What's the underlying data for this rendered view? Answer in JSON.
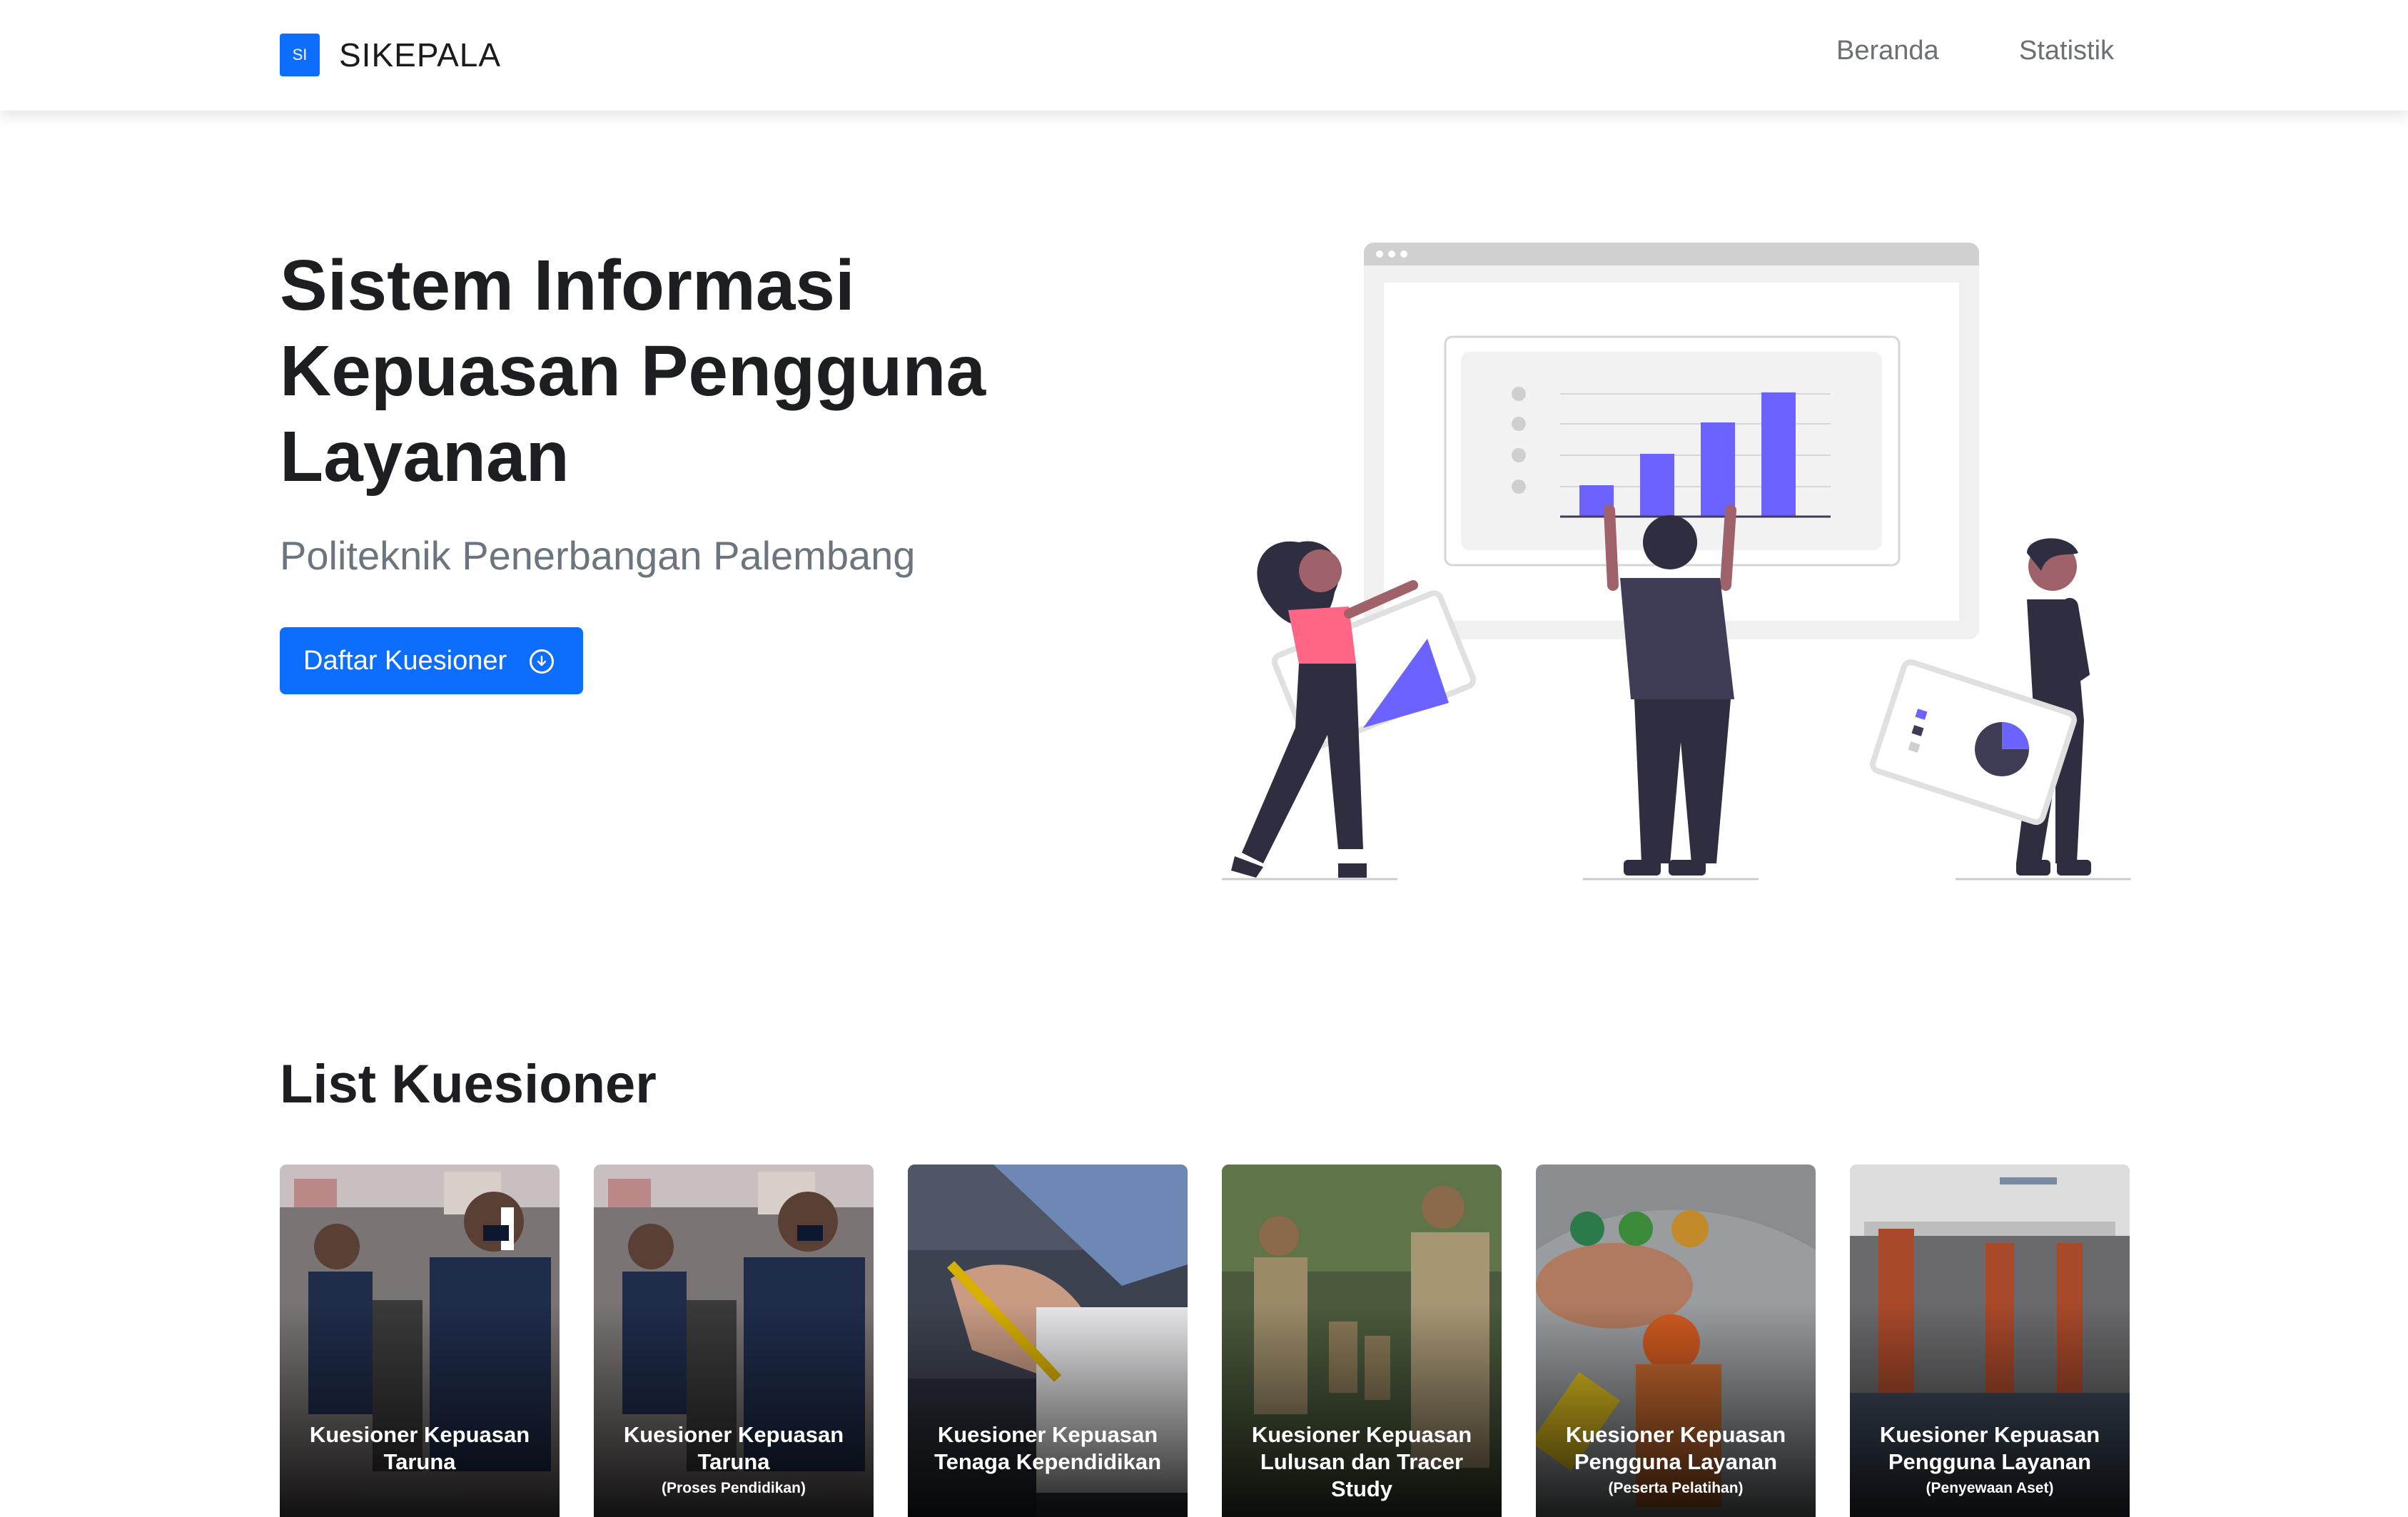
{
  "navbar": {
    "logo_text": "SI",
    "brand": "SIKEPALA",
    "links": [
      "Beranda",
      "Statistik"
    ]
  },
  "hero": {
    "title": "Sistem Informasi Kepuasan Pengguna Layanan",
    "subtitle": "Politeknik Penerbangan Palembang",
    "button_label": "Daftar Kuesioner",
    "button_icon": "arrow-down-circle-icon"
  },
  "list": {
    "title": "List Kuesioner",
    "cards": [
      {
        "title": "Kuesioner Kepuasan Taruna",
        "subtitle": ""
      },
      {
        "title": "Kuesioner Kepuasan Taruna",
        "subtitle": "(Proses Pendidikan)"
      },
      {
        "title": "Kuesioner Kepuasan Tenaga Kependidikan",
        "subtitle": ""
      },
      {
        "title": "Kuesioner Kepuasan Lulusan dan Tracer Study",
        "subtitle": ""
      },
      {
        "title": "Kuesioner Kepuasan Pengguna Layanan",
        "subtitle": "(Peserta Pelatihan)"
      },
      {
        "title": "Kuesioner Kepuasan Pengguna Layanan",
        "subtitle": "(Penyewaan Aset)"
      }
    ]
  },
  "colors": {
    "primary": "#0d6efd",
    "accent_purple": "#6c63ff",
    "figure_dark": "#2f2e41"
  }
}
